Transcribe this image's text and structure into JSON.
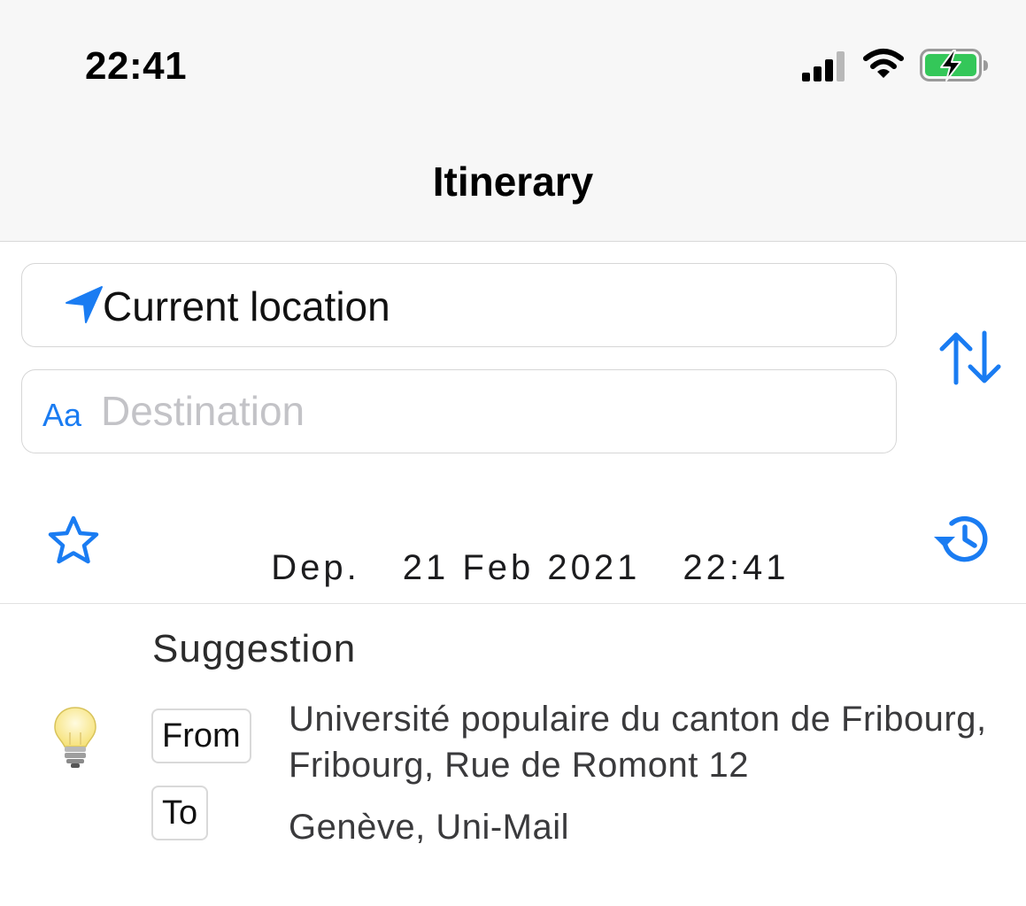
{
  "status_bar": {
    "time": "22:41",
    "icons": [
      "cellular-signal-icon",
      "wifi-icon",
      "battery-charging-icon"
    ]
  },
  "nav": {
    "title": "Itinerary"
  },
  "search": {
    "origin": {
      "icon": "location-arrow-icon",
      "value": "Current location"
    },
    "destination": {
      "icon_text": "Aa",
      "placeholder": "Destination",
      "value": ""
    },
    "swap_icon": "swap-arrows-icon"
  },
  "departure": {
    "label": "Dep.",
    "date": "21 Feb 2021",
    "time": "22:41",
    "favorite_icon": "star-outline-icon",
    "history_icon": "history-clock-icon"
  },
  "suggestion": {
    "title": "Suggestion",
    "icon": "lightbulb-icon",
    "from_label": "From",
    "from_value": "Université populaire du canton de Fribourg, Fribourg, Rue de Romont 12",
    "to_label": "To",
    "to_value": "Genève, Uni-Mail"
  },
  "colors": {
    "accent": "#1a7cf2",
    "battery_green": "#34c759",
    "header_bg": "#f7f7f7",
    "placeholder": "#c3c3c7"
  }
}
